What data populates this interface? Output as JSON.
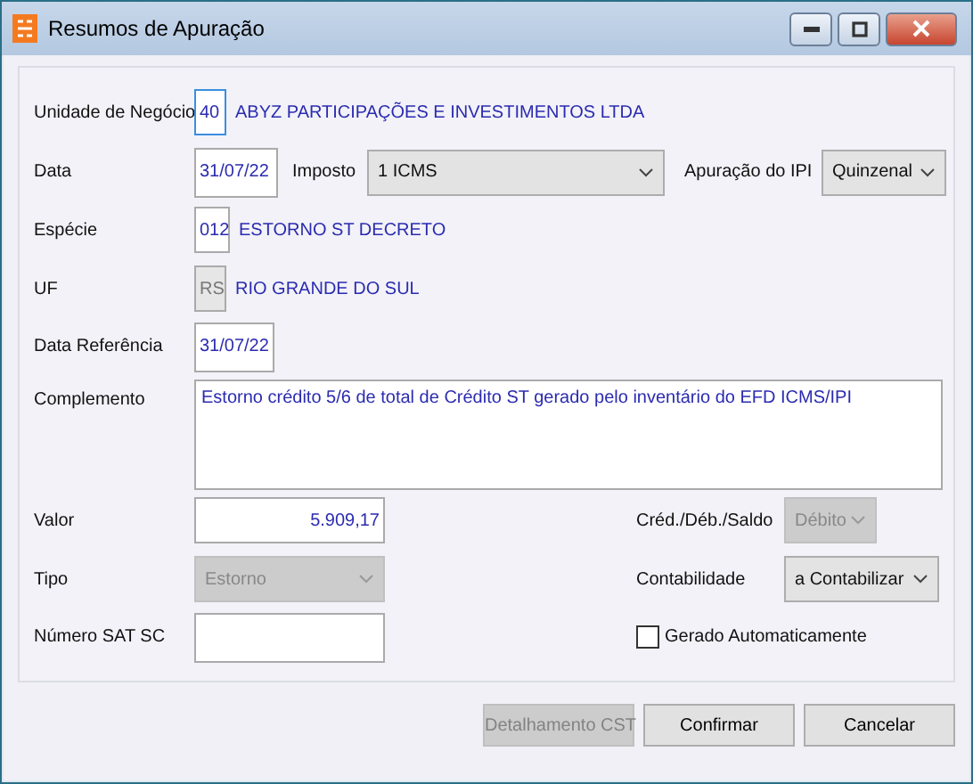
{
  "window": {
    "title": "Resumos de Apuração"
  },
  "form": {
    "unidade": {
      "label": "Unidade de Negócio",
      "code": "40",
      "name": "ABYZ PARTICIPAÇÕES E INVESTIMENTOS LTDA"
    },
    "data": {
      "label": "Data",
      "value": "31/07/22"
    },
    "imposto": {
      "label": "Imposto",
      "value": "1 ICMS",
      "disabled": false
    },
    "apuracao_ipi": {
      "label": "Apuração do IPI",
      "value": "Quinzenal",
      "disabled": false
    },
    "especie": {
      "label": "Espécie",
      "code": "012",
      "name": "ESTORNO ST DECRETO"
    },
    "uf": {
      "label": "UF",
      "code": "RS",
      "name": "RIO GRANDE DO SUL",
      "disabled": true
    },
    "data_referencia": {
      "label": "Data Referência",
      "value": "31/07/22"
    },
    "complemento": {
      "label": "Complemento",
      "value": "Estorno crédito 5/6 de total de Crédito ST gerado pelo inventário do EFD ICMS/IPI"
    },
    "valor": {
      "label": "Valor",
      "value": "5.909,17"
    },
    "cred_deb_saldo": {
      "label": "Créd./Déb./Saldo",
      "value": "Débito",
      "disabled": true
    },
    "tipo": {
      "label": "Tipo",
      "value": "Estorno",
      "disabled": true
    },
    "contabilidade": {
      "label": "Contabilidade",
      "value": "a Contabilizar",
      "disabled": false
    },
    "numero_sat_sc": {
      "label": "Número SAT SC"
    },
    "gerado_automaticamente": {
      "label": "Gerado Automaticamente",
      "checked": false
    }
  },
  "buttons": [
    {
      "label": "Detalhamento CST",
      "disabled": true
    },
    {
      "label": "Confirmar",
      "disabled": false
    },
    {
      "label": "Cancelar",
      "disabled": false
    }
  ]
}
